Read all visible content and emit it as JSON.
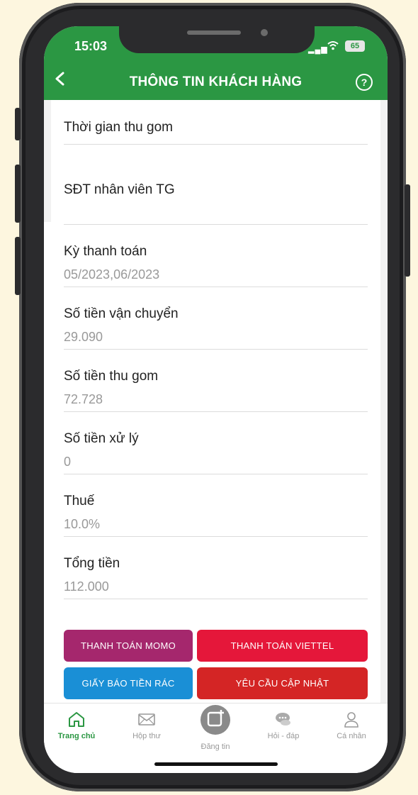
{
  "status": {
    "time": "15:03",
    "battery": "65"
  },
  "header": {
    "title": "THÔNG TIN KHÁCH HÀNG"
  },
  "fields": [
    {
      "label": "Thời gian thu gom",
      "value": ""
    },
    {
      "label": "SĐT nhân viên TG",
      "value": ""
    },
    {
      "label": "Kỳ thanh toán",
      "value": "05/2023,06/2023"
    },
    {
      "label": "Số tiền vận chuyển",
      "value": "29.090"
    },
    {
      "label": "Số tiền thu gom",
      "value": "72.728"
    },
    {
      "label": "Số tiền xử lý",
      "value": "0"
    },
    {
      "label": "Thuế",
      "value": "10.0%"
    },
    {
      "label": "Tổng tiền",
      "value": "112.000"
    }
  ],
  "buttons": {
    "momo": "THANH TOÁN MOMO",
    "viettel": "THANH TOÁN VIETTEL",
    "bill": "GIẤY BÁO TIỀN RÁC",
    "update": "YÊU CẦU CẬP NHẬT"
  },
  "nav": {
    "home": "Trang chủ",
    "inbox": "Hộp thư",
    "post": "Đăng tin",
    "qa": "Hỏi - đáp",
    "profile": "Cá nhân"
  },
  "colors": {
    "brand_green": "#2b9743",
    "momo": "#a5276d",
    "viettel": "#e5173a",
    "bill": "#1a8fd6",
    "update": "#d42525"
  }
}
